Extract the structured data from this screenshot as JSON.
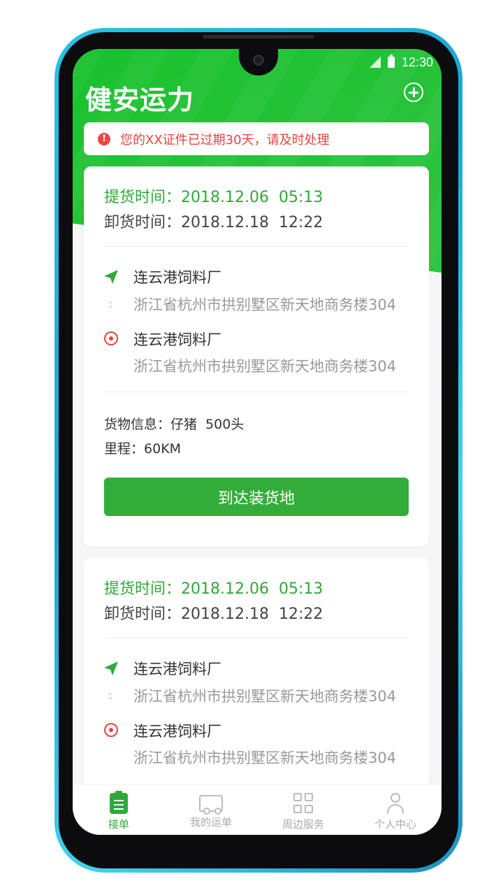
{
  "status_bar": {
    "time": "12:30"
  },
  "header": {
    "title": "健安运力"
  },
  "alert": {
    "text": "您的XX证件已过期30天，请及时处理"
  },
  "orders": [
    {
      "pickup_label": "提货时间：",
      "pickup_date": "2018.12.06",
      "pickup_time": "05:13",
      "unload_label": "卸货时间：",
      "unload_date": "2018.12.18",
      "unload_time": "12:22",
      "origin_name": "连云港饲料厂",
      "origin_address": "浙江省杭州市拱别墅区新天地商务楼304",
      "dest_name": "连云港饲料厂",
      "dest_address": "浙江省杭州市拱别墅区新天地商务楼304",
      "cargo_label": "货物信息：",
      "cargo_type": "仔猪",
      "cargo_qty": "500头",
      "mileage_label": "里程：",
      "mileage": "60KM",
      "action_label": "到达装货地"
    },
    {
      "pickup_label": "提货时间：",
      "pickup_date": "2018.12.06",
      "pickup_time": "05:13",
      "unload_label": "卸货时间：",
      "unload_date": "2018.12.18",
      "unload_time": "12:22",
      "origin_name": "连云港饲料厂",
      "origin_address": "浙江省杭州市拱别墅区新天地商务楼304",
      "dest_name": "连云港饲料厂",
      "dest_address": "浙江省杭州市拱别墅区新天地商务楼304"
    }
  ],
  "tabbar": {
    "tabs": [
      {
        "label": "接单",
        "icon": "clipboard-icon",
        "active": true
      },
      {
        "label": "我的运单",
        "icon": "truck-icon",
        "active": false
      },
      {
        "label": "周边服务",
        "icon": "grid-icon",
        "active": false
      },
      {
        "label": "个人中心",
        "icon": "user-icon",
        "active": false
      }
    ]
  },
  "colors": {
    "brand_green": "#2fa93a",
    "header_green": "#1fc232",
    "alert_red": "#e9433c",
    "phone_frame": "#27c3e6"
  }
}
